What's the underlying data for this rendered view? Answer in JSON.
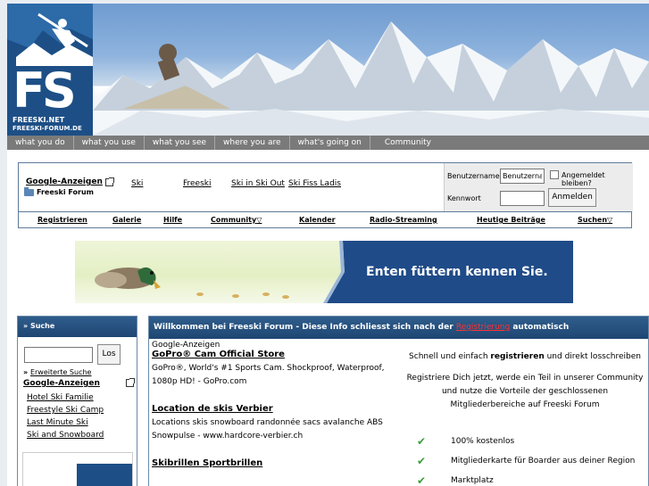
{
  "logo": {
    "mark": "FS",
    "site1": "FREESKI.NET",
    "site2": "FREESKI-FORUM.DE"
  },
  "nav": [
    "what you do",
    "what you use",
    "what you see",
    "where you are",
    "what's going on",
    "Community"
  ],
  "topbar": {
    "ads_title": "Google-Anzeigen",
    "ad_links": [
      "Ski",
      "Freeski",
      "Ski in Ski Out",
      "Ski Fiss Ladis"
    ],
    "forum_name": "Freeski Forum",
    "login": {
      "username_label": "Benutzername",
      "username_value": "Benutzernam",
      "remember_label": "Angemeldet bleiben?",
      "password_label": "Kennwort",
      "submit_label": "Anmelden"
    },
    "menu": [
      "Registrieren",
      "Galerie",
      "Hilfe",
      "Community",
      "Kalender",
      "Radio-Streaming",
      "Heutige Beiträge",
      "Suchen"
    ],
    "menu_dropdown_glyph": "▽"
  },
  "banner_ad": {
    "slogan": "Enten füttern kennen Sie."
  },
  "sidebar": {
    "title": "» Suche",
    "search_button": "Los",
    "advanced_prefix": "» ",
    "advanced_label": "Erweiterte Suche",
    "ads_title": "Google-Anzeigen",
    "links": [
      "Hotel Ski Familie",
      "Freestyle Ski Camp",
      "Last Minute Ski",
      "Ski and Snowboard"
    ]
  },
  "main": {
    "header_prefix": "Willkommen bei Freeski Forum - Diese Info schliesst sich nach der ",
    "header_link": "Registrierung",
    "header_suffix": " automatisch",
    "ads_label": "Google-Anzeigen",
    "ads": [
      {
        "title": "GoPro® Cam Official Store",
        "text": "GoPro®, World's #1 Sports Cam. Shockproof, Waterproof, 1080p HD! - GoPro.com"
      },
      {
        "title": "Location de skis Verbier",
        "text": "Locations skis snowboard randonnée sacs avalanche ABS Snowpulse - www.hardcore-verbier.ch"
      },
      {
        "title": "Skibrillen Sportbrillen",
        "text": ""
      }
    ],
    "promo_line1_prefix": "Schnell und einfach ",
    "promo_line1_bold": "registrieren",
    "promo_line1_suffix": " und direkt losschreiben",
    "promo_line2": "Registriere Dich jetzt, werde ein Teil in unserer Community und nutze die Vorteile der geschlossenen Mitgliederbereiche auf Freeski Forum",
    "benefits": [
      "100% kostenlos",
      "Mitgliederkarte für Boarder aus deiner Region",
      "Marktplatz"
    ]
  },
  "colors": {
    "header_blue": "#1f4673",
    "register_red": "#ff3333",
    "check_green": "#3aa03a"
  }
}
